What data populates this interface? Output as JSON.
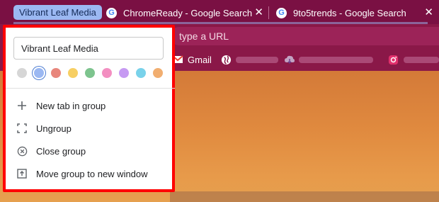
{
  "tabs": {
    "group_label": "Vibrant Leaf Media",
    "items": [
      {
        "title": "ChromeReady - Google Search",
        "favicon": "google-icon",
        "close": "✕"
      },
      {
        "title": "9to5trends - Google Search",
        "favicon": "google-icon",
        "close": "✕"
      }
    ]
  },
  "omnibox": {
    "placeholder_text": "type a URL"
  },
  "bookmarks": [
    {
      "label": "Gmail",
      "icon": "gmail-icon"
    }
  ],
  "group_menu": {
    "name_value": "Vibrant Leaf Media",
    "colors": [
      "#d6d6d6",
      "#9bb8f2",
      "#e8867c",
      "#f7cf63",
      "#7dc48e",
      "#f38fc1",
      "#c69af2",
      "#79d2ea",
      "#f1ae70"
    ],
    "selected_color_index": 1,
    "items": [
      {
        "label": "New tab in group",
        "icon": "plus-icon"
      },
      {
        "label": "Ungroup",
        "icon": "ungroup-icon"
      },
      {
        "label": "Close group",
        "icon": "close-circle-icon"
      },
      {
        "label": "Move group to new window",
        "icon": "move-window-icon"
      }
    ]
  },
  "colors": {
    "frame": "#7a1043",
    "highlight": "#ff0000",
    "group_chip": "#9bb8f2"
  }
}
